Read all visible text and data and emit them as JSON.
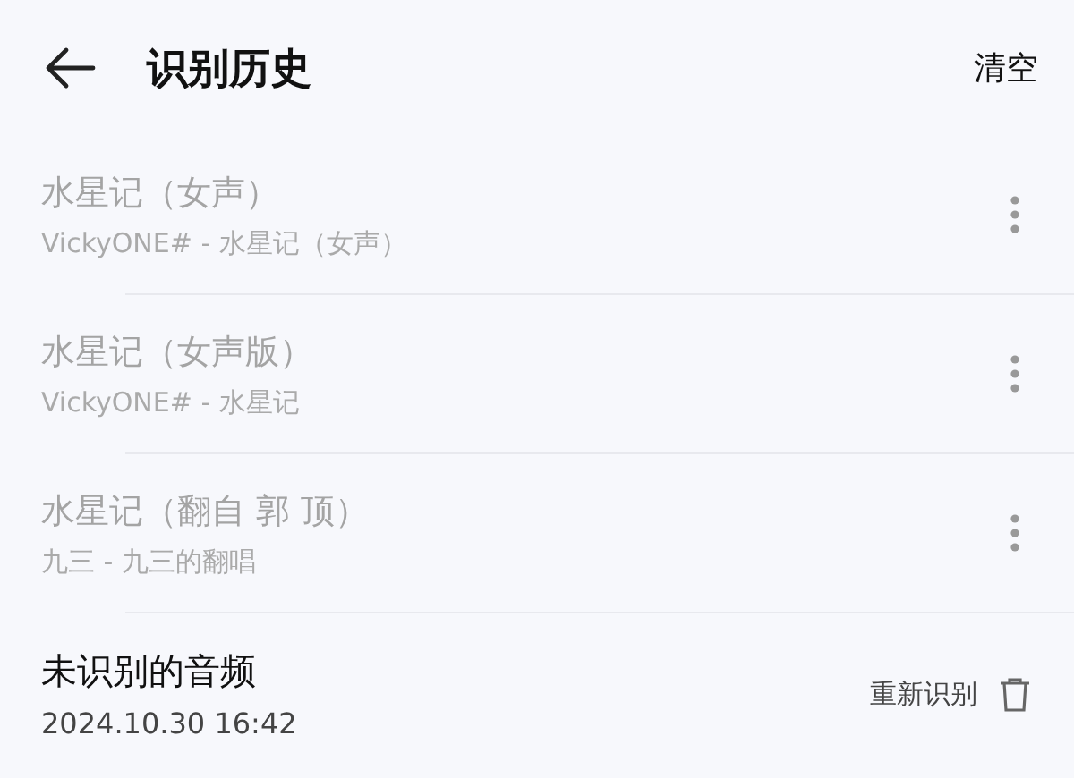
{
  "header": {
    "title": "识别历史",
    "action": "清空"
  },
  "records": [
    {
      "kind": "song",
      "title": "水星记（女声）",
      "subtitle": "VickyONE# - 水星记（女声）"
    },
    {
      "kind": "song",
      "title": "水星记（女声版）",
      "subtitle": "VickyONE# - 水星记"
    },
    {
      "kind": "song",
      "title": "水星记（翻自 郭 顶）",
      "subtitle": "九三 - 九三的翻唱"
    },
    {
      "kind": "unrecognized",
      "title": "未识别的音频",
      "subtitle": "2024.10.30 16:42",
      "action": "重新识别"
    }
  ]
}
